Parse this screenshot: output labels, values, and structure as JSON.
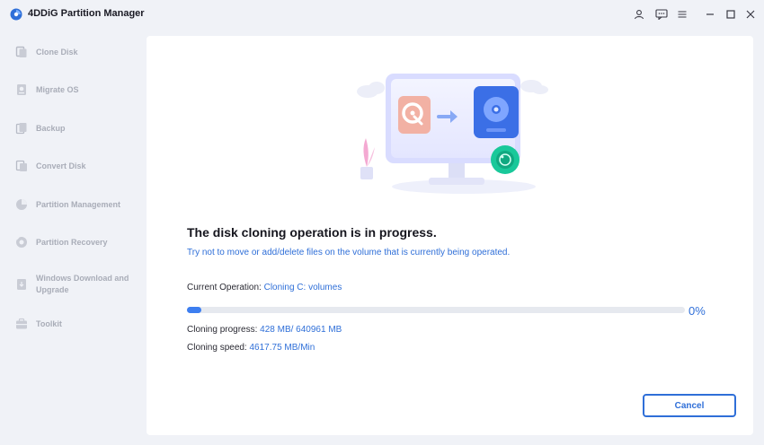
{
  "app": {
    "title": "4DDiG Partition Manager"
  },
  "titlebar": {
    "buttons": [
      "user-icon",
      "feedback-icon",
      "menu-icon",
      "minimize-icon",
      "maximize-icon",
      "close-icon"
    ]
  },
  "sidebar": {
    "items": [
      {
        "label": "Clone Disk",
        "icon": "clone-disk-icon"
      },
      {
        "label": "Migrate OS",
        "icon": "migrate-os-icon"
      },
      {
        "label": "Backup",
        "icon": "backup-icon"
      },
      {
        "label": "Convert Disk",
        "icon": "convert-disk-icon"
      },
      {
        "label": "Partition Management",
        "icon": "partition-management-icon"
      },
      {
        "label": "Partition Recovery",
        "icon": "partition-recovery-icon"
      },
      {
        "label": "Windows Download and Upgrade",
        "icon": "windows-download-icon"
      },
      {
        "label": "Toolkit",
        "icon": "toolkit-icon"
      }
    ]
  },
  "main": {
    "heading": "The disk cloning operation is in progress.",
    "subtitle": "Try not to move or add/delete files on the volume that is currently being operated.",
    "current_operation": {
      "label": "Current Operation:",
      "value": "Cloning C: volumes"
    },
    "progress": {
      "percent_text": "0%",
      "fraction": 0.028
    },
    "cloning_progress": {
      "label": "Cloning progress:",
      "value": "428 MB/ 640961 MB"
    },
    "cloning_speed": {
      "label": "Cloning speed:",
      "value": "4617.75 MB/Min"
    },
    "cancel_label": "Cancel"
  },
  "colors": {
    "accent": "#2f6fd8",
    "progress_fill": "#3d7ef0",
    "sidebar_text": "#a9adb8"
  }
}
